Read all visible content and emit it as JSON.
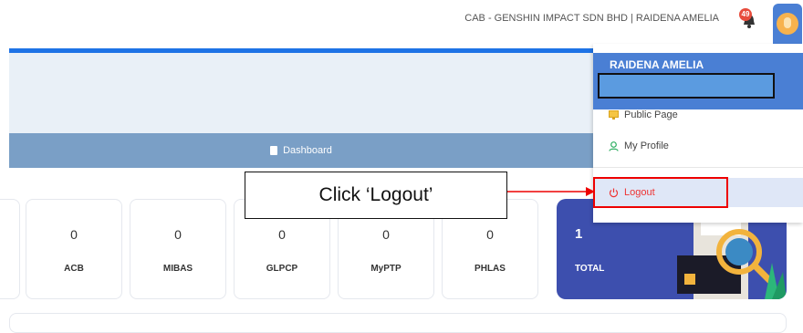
{
  "header": {
    "org_line": "CAB - GENSHIN IMPACT SDN BHD | RAIDENA AMELIA",
    "notification_count": "49"
  },
  "nav": {
    "dashboard_label": "Dashboard"
  },
  "stats": [
    {
      "value": "0",
      "label": "ACB"
    },
    {
      "value": "0",
      "label": "MIBAS"
    },
    {
      "value": "0",
      "label": "GLPCP"
    },
    {
      "value": "0",
      "label": "MyPTP"
    },
    {
      "value": "0",
      "label": "PHLAS"
    }
  ],
  "total": {
    "value": "1",
    "label": "TOTAL"
  },
  "dropdown": {
    "user_name": "RAIDENA AMELIA",
    "items": [
      {
        "label": "Public Page",
        "icon": "monitor-icon"
      },
      {
        "label": "My Profile",
        "icon": "user-icon"
      },
      {
        "label": "Logout",
        "icon": "power-icon"
      }
    ]
  },
  "annotation": {
    "callout_text": "Click ‘Logout’"
  },
  "colors": {
    "accent": "#1e73e6",
    "navbar": "#7a9fc6",
    "total_card": "#3d4fae",
    "dropdown_header": "#4a7fd4",
    "logout": "#e33333"
  }
}
